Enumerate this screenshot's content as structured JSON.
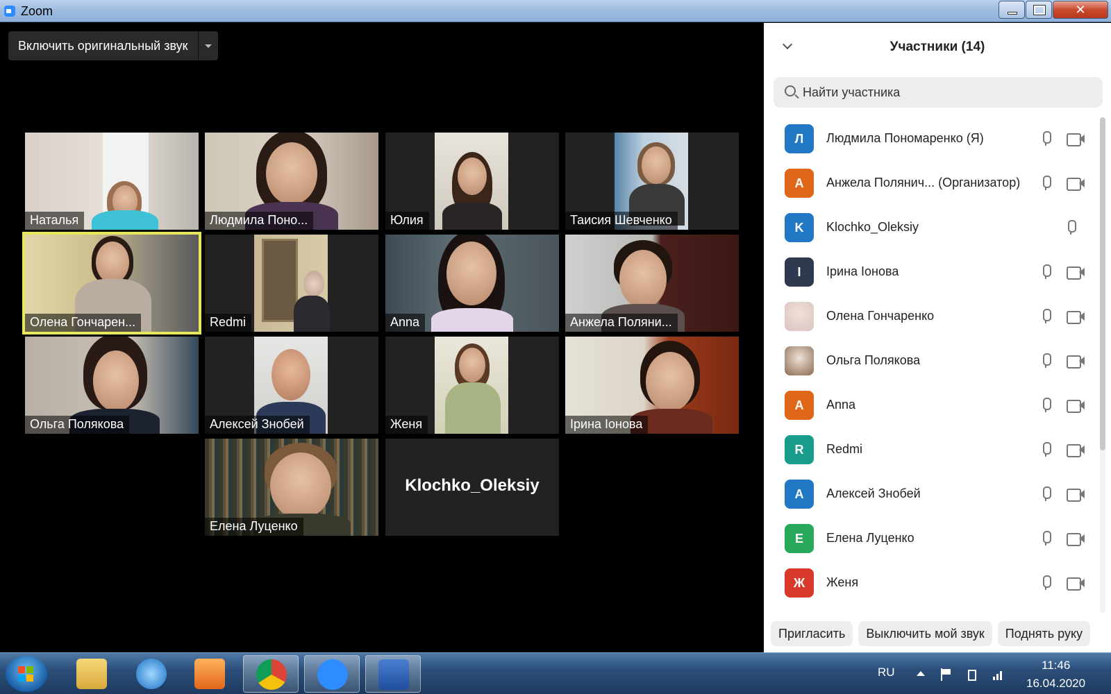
{
  "window": {
    "title": "Zoom"
  },
  "toolbar": {
    "original_sound_label": "Включить оригинальный звук"
  },
  "gallery": {
    "tiles": [
      {
        "name": "Наталья"
      },
      {
        "name": "Людмила Поно..."
      },
      {
        "name": "Юлия"
      },
      {
        "name": "Таисия Шевченко"
      },
      {
        "name": "Олена Гончарен..."
      },
      {
        "name": "Redmi"
      },
      {
        "name": "Anna"
      },
      {
        "name": "Анжела Поляни..."
      },
      {
        "name": "Ольга Полякова"
      },
      {
        "name": "Алексей Знобей"
      },
      {
        "name": "Женя"
      },
      {
        "name": "Ірина Іонова"
      },
      {
        "name": "Елена Луценко"
      },
      {
        "name": "Klochko_Oleksiy"
      }
    ]
  },
  "participants": {
    "title": "Участники (14)",
    "search_placeholder": "Найти участника",
    "list": [
      {
        "initial": "Л",
        "name": "Людмила Пономаренко (Я)",
        "color": "#2179c6",
        "mic": true,
        "cam": true
      },
      {
        "initial": "А",
        "name": "Анжела Полянич... (Организатор)",
        "color": "#e0671a",
        "mic": true,
        "cam": true
      },
      {
        "initial": "K",
        "name": "Klochko_Oleksiy",
        "color": "#2179c6",
        "mic": true,
        "cam": false
      },
      {
        "initial": "І",
        "name": "Ірина Іонова",
        "color": "#2e3a4f",
        "mic": true,
        "cam": true
      },
      {
        "initial": "",
        "name": "Олена Гончаренко",
        "color": "#d9c2c0",
        "mic": true,
        "cam": true
      },
      {
        "initial": "",
        "name": "Ольга Полякова",
        "color": "#8a6a50",
        "mic": true,
        "cam": true
      },
      {
        "initial": "A",
        "name": "Anna",
        "color": "#e0671a",
        "mic": true,
        "cam": true
      },
      {
        "initial": "R",
        "name": "Redmi",
        "color": "#1a9c8c",
        "mic": true,
        "cam": true
      },
      {
        "initial": "А",
        "name": "Алексей Знобей",
        "color": "#2179c6",
        "mic": true,
        "cam": true
      },
      {
        "initial": "Е",
        "name": "Елена Луценко",
        "color": "#27a85a",
        "mic": true,
        "cam": true
      },
      {
        "initial": "Ж",
        "name": "Женя",
        "color": "#d8392b",
        "mic": true,
        "cam": true
      }
    ],
    "buttons": {
      "invite": "Пригласить",
      "mute": "Выключить мой звук",
      "raise": "Поднять руку"
    }
  },
  "taskbar": {
    "language": "RU",
    "time": "11:46",
    "date": "16.04.2020"
  },
  "colors": {
    "active_speaker": "#e5e85a",
    "panel_bg": "#ffffff",
    "video_bg": "#000000"
  }
}
